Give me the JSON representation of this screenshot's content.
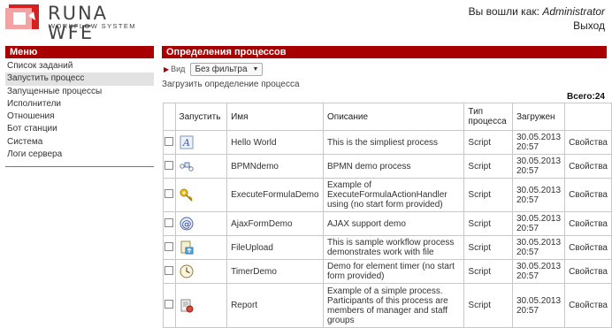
{
  "header": {
    "logo_title": "RUNA WFE",
    "logo_subtitle": "WORKFLOW SYSTEM",
    "logged_in_label": "Вы вошли как:",
    "username": "Administrator",
    "logout_label": "Выход"
  },
  "sidebar": {
    "title": "Меню",
    "items": [
      {
        "label": "Список заданий"
      },
      {
        "label": "Запустить процесс"
      },
      {
        "label": "Запущенные процессы"
      },
      {
        "label": "Исполнители"
      },
      {
        "label": "Отношения"
      },
      {
        "label": "Бот станции"
      },
      {
        "label": "Система"
      },
      {
        "label": "Логи сервера"
      }
    ],
    "active_index": 1
  },
  "main": {
    "title": "Определения процессов",
    "filter": {
      "label": "Вид",
      "selected": "Без фильтра"
    },
    "upload_label": "Загрузить определение процесса",
    "total_label": "Всего:24",
    "columns": {
      "start": "Запустить",
      "name": "Имя",
      "description": "Описание",
      "type": "Тип процесса",
      "loaded": "Загружен",
      "props": ""
    },
    "rows": [
      {
        "icon": "text-a-icon",
        "name": "Hello World",
        "description": "This is the simpliest process",
        "type": "Script",
        "loaded": "30.05.2013 20:57",
        "props": "Свойства"
      },
      {
        "icon": "bpmn-diagram-icon",
        "name": "BPMNdemo",
        "description": "BPMN demo process",
        "type": "Script",
        "loaded": "30.05.2013 20:57",
        "props": "Свойства"
      },
      {
        "icon": "key-icon",
        "name": "ExecuteFormulaDemo",
        "description": "Example of ExecuteFormulaActionHandler using (no start form provided)",
        "type": "Script",
        "loaded": "30.05.2013 20:57",
        "props": "Свойства"
      },
      {
        "icon": "at-sign-icon",
        "name": "AjaxFormDemo",
        "description": "AJAX support demo",
        "type": "Script",
        "loaded": "30.05.2013 20:57",
        "props": "Свойства"
      },
      {
        "icon": "file-upload-icon",
        "name": "FileUpload",
        "description": "This is sample workflow process demonstrates work with file",
        "type": "Script",
        "loaded": "30.05.2013 20:57",
        "props": "Свойства"
      },
      {
        "icon": "clock-icon",
        "name": "TimerDemo",
        "description": "Demo for element timer (no start form provided)",
        "type": "Script",
        "loaded": "30.05.2013 20:57",
        "props": "Свойства"
      },
      {
        "icon": "report-icon",
        "name": "Report",
        "description": "Example of a simple process. Participants of this process are members of manager and staff groups",
        "type": "Script",
        "loaded": "30.05.2013 20:57",
        "props": "Свойства"
      }
    ]
  },
  "colors": {
    "accent": "#a80000",
    "active_item_bg": "#e2e2e2",
    "table_border": "#c8c8c8"
  }
}
